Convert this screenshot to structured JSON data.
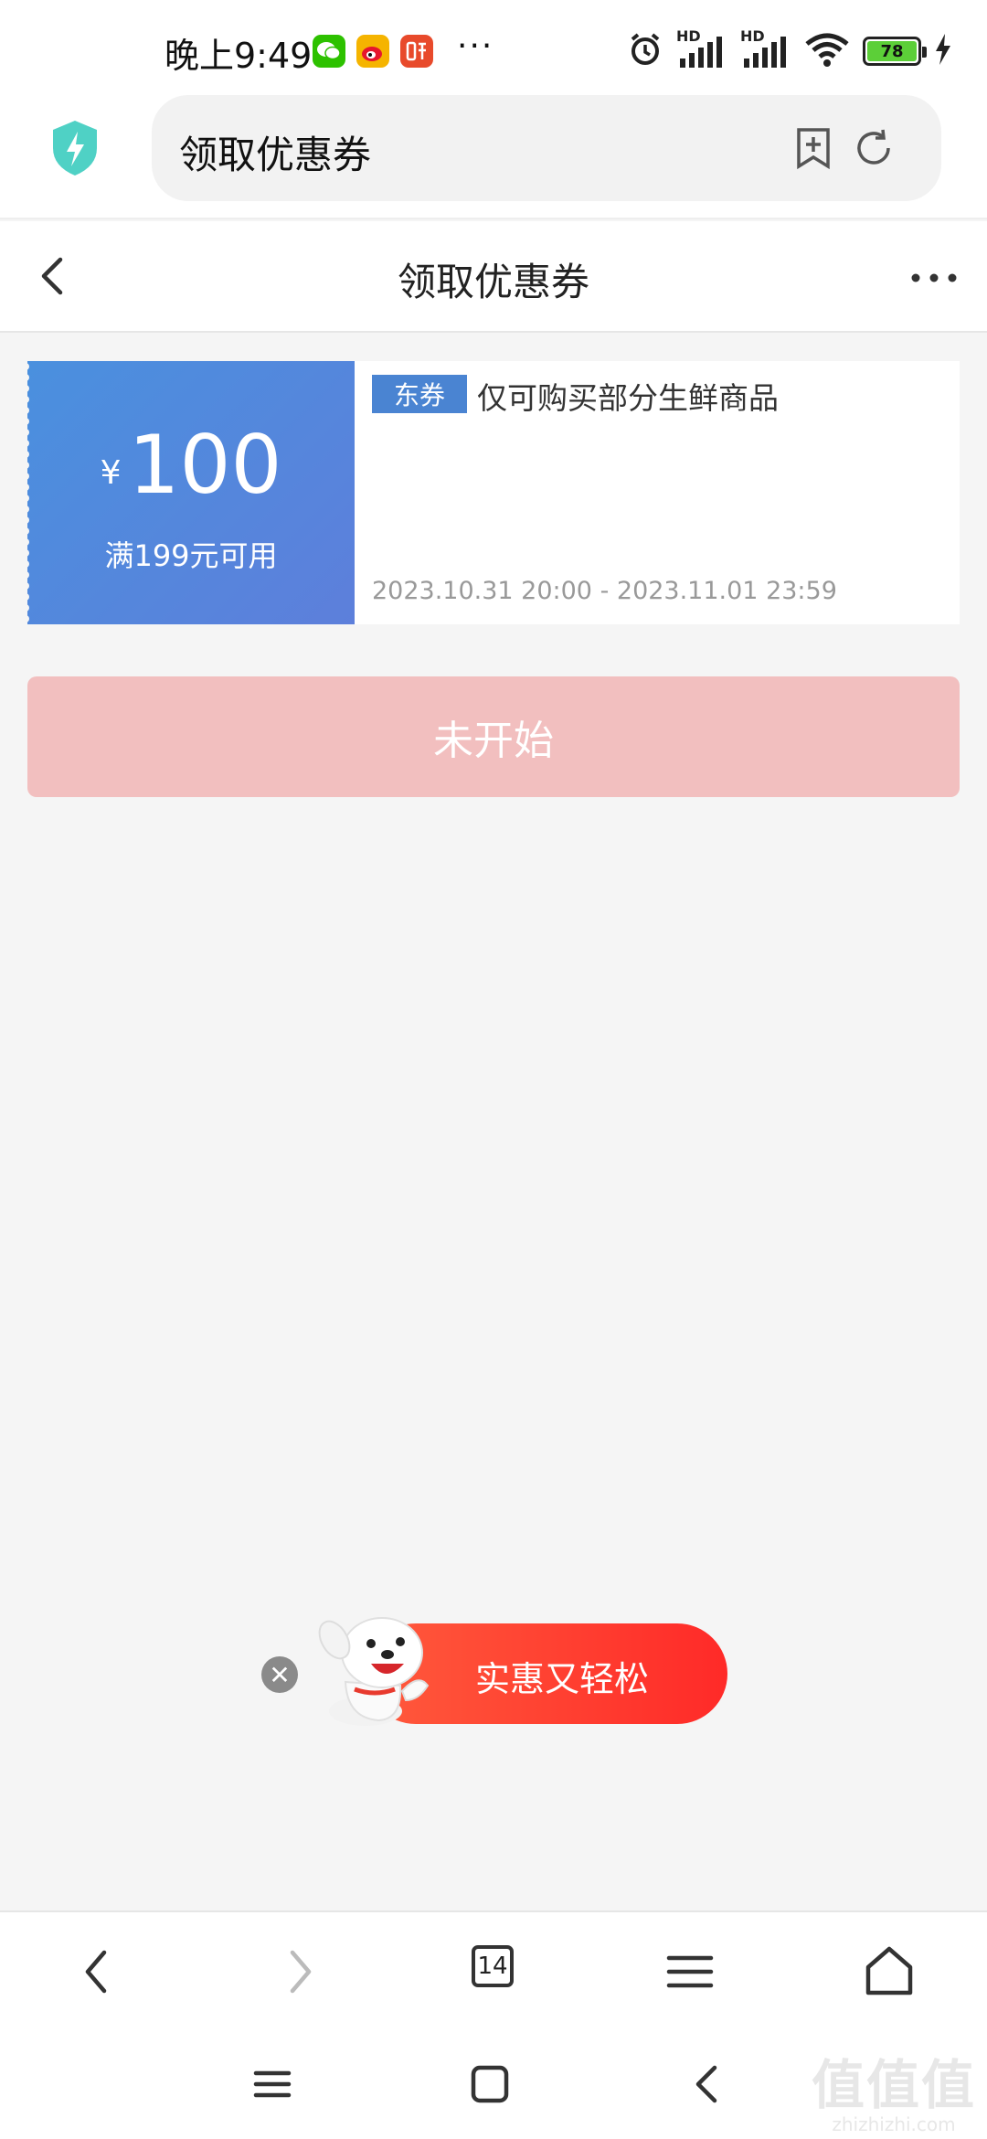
{
  "status_bar": {
    "time": "晚上9:49",
    "more_dots": "···",
    "network_label_1": "HD",
    "network_label_2": "HD",
    "battery_level": "78",
    "app_icons": [
      "wechat-icon",
      "weibo-icon",
      "listen-app-icon"
    ],
    "colors": {
      "wechat": "#2dc100",
      "weibo": "#f5b400",
      "listen": "#e84a2b"
    }
  },
  "browser": {
    "url_text": "领取优惠券",
    "icons": [
      "shield-icon",
      "bookmark-add-icon",
      "refresh-icon"
    ]
  },
  "page": {
    "title": "领取优惠券"
  },
  "coupon": {
    "currency": "¥",
    "amount": "100",
    "condition": "满199元可用",
    "tag": "东券",
    "description": "仅可购买部分生鲜商品",
    "validity": "2023.10.31 20:00 - 2023.11.01 23:59",
    "colors": {
      "left_start": "#4a90de",
      "left_end": "#5d7fdb",
      "tag": "#4a84d2"
    }
  },
  "action": {
    "button_label": "未开始",
    "color": "#f2bfbf"
  },
  "promo": {
    "label": "实惠又轻松",
    "close_glyph": "✕",
    "color": "#ff2a28"
  },
  "bottom_nav": {
    "tab_count": "14",
    "icons": [
      "back-icon",
      "forward-icon",
      "tabs-icon",
      "menu-icon",
      "home-icon"
    ]
  },
  "system_nav": {
    "icons": [
      "recents-icon",
      "home-icon",
      "back-icon"
    ]
  },
  "watermark": {
    "top": "值值值",
    "bottom": "zhizhizhi.com"
  }
}
